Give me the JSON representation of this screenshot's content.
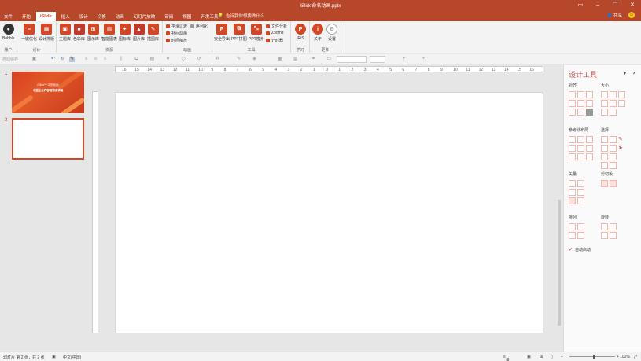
{
  "window": {
    "title": "iSlide命名动画.pptx"
  },
  "tabs": [
    "文件",
    "开始",
    "iSlide",
    "插入",
    "设计",
    "切换",
    "动画",
    "幻灯片放映",
    "审阅",
    "视图",
    "开发工具"
  ],
  "tellme": "告诉我你想要做什么",
  "account": {
    "share": "共享"
  },
  "ribbon": {
    "account_group": {
      "user": "Bobble",
      "label": "账户"
    },
    "design_group": {
      "btn1": "一键优化",
      "btn2": "设计排版",
      "label": "设计"
    },
    "resources_group": {
      "btns": [
        "主题库",
        "色彩库",
        "图示库",
        "智能图表",
        "图标库",
        "图片库",
        "插图库"
      ],
      "label": "资源"
    },
    "animation_group": {
      "items": [
        "平滑过渡",
        "补间动画",
        "时间缩放",
        "序列化"
      ],
      "label": "动画"
    },
    "tools_group": {
      "btns": [
        "安全导出",
        "PPT拼图",
        "PPT瘦身"
      ],
      "items": [
        "文件分析",
        "ZoomIt",
        "计时器"
      ],
      "label": "工具"
    },
    "learn_group": {
      "btn": "iRiS",
      "label": "学习"
    },
    "more_group": {
      "btns": [
        "关于",
        "设置"
      ],
      "label": "更多"
    }
  },
  "qat": {
    "label": "自动保存"
  },
  "slides": {
    "numbers": [
      "1",
      "2"
    ],
    "thumb1_line1": "iSlide™ 中的动画",
    "thumb1_line2": "中国企业内容营销演讲稿"
  },
  "ruler_ticks": [
    "16",
    "15",
    "14",
    "13",
    "12",
    "11",
    "10",
    "9",
    "8",
    "7",
    "6",
    "5",
    "4",
    "3",
    "2",
    "1",
    "0",
    "1",
    "2",
    "3",
    "4",
    "5",
    "6",
    "7",
    "8",
    "9",
    "10",
    "11",
    "12",
    "13",
    "14",
    "15",
    "16"
  ],
  "panel": {
    "title": "设计工具",
    "sections": {
      "align": "对齐",
      "size": "大小",
      "guides": "参考线布局",
      "select": "选择",
      "vector": "矢量",
      "clip": "剪切板",
      "order": "排列",
      "rotate": "旋转"
    },
    "auto_launch": "自动启动"
  },
  "status": {
    "slide_info": "幻灯片 第 2 张，共 2 张",
    "language": "中文(中国)",
    "notes": "备注",
    "zoom": "100%"
  },
  "colors": {
    "accent": "#b7472a",
    "panel_title": "#c0504d"
  }
}
